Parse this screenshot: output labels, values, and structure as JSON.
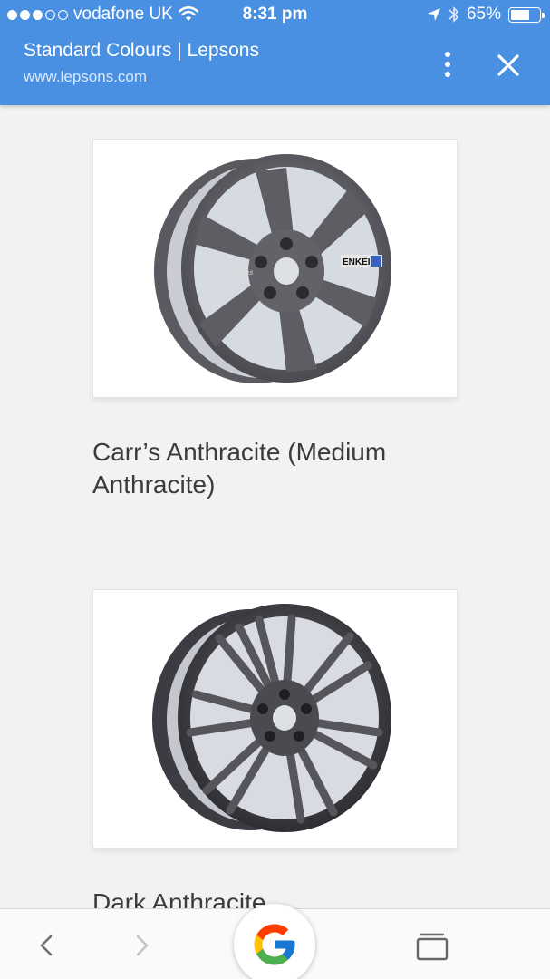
{
  "status_bar": {
    "carrier": "vodafone UK",
    "time": "8:31 pm",
    "battery": "65%",
    "battery_level": 0.65,
    "signal_bars": 3,
    "icons": [
      "wifi-icon",
      "location-arrow-icon",
      "bluetooth-icon",
      "battery-icon"
    ]
  },
  "header": {
    "title": "Standard Colours | Lepsons",
    "url": "www.lepsons.com",
    "menu_icon": "more-vertical-icon",
    "close_icon": "close-icon"
  },
  "colours": [
    {
      "name": "Carr’s Anthracite (Medium Anthracite)",
      "image": "six-spoke-alloy-wheel"
    },
    {
      "name": "Dark Anthracite",
      "image": "split-spoke-alloy-wheel"
    }
  ],
  "wheel_badge": {
    "brand": "ENKEI",
    "script": "Lepsons"
  },
  "toolbar": {
    "back_icon": "chevron-left-icon",
    "forward_icon": "chevron-right-icon",
    "google_icon": "google-g-icon",
    "tabs_icon": "tabs-icon"
  },
  "colors": {
    "accent": "#4a90e2",
    "background": "#f2f2f2",
    "text": "#3b3b3b"
  }
}
